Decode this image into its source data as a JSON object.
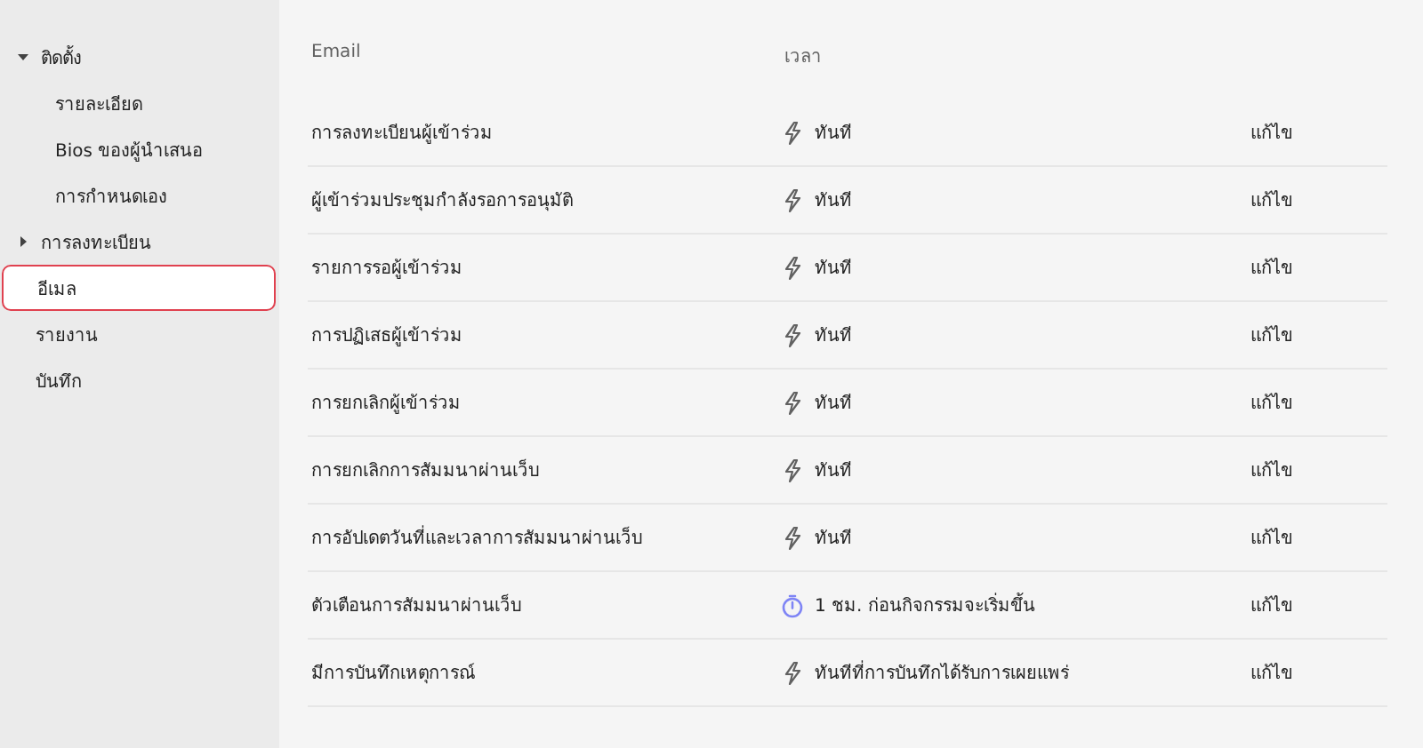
{
  "sidebar": {
    "items": [
      {
        "label": "ติดตั้ง",
        "expanded": true,
        "selected": false,
        "children": [
          {
            "label": "รายละเอียด",
            "selected": false
          },
          {
            "label": "Bios ของผู้นำเสนอ",
            "selected": false
          },
          {
            "label": "การกำหนดเอง",
            "selected": false
          }
        ]
      },
      {
        "label": "การลงทะเบียน",
        "expanded": false,
        "selected": false
      },
      {
        "label": "อีเมล",
        "selected": true
      },
      {
        "label": "รายงาน",
        "selected": false
      },
      {
        "label": "บันทึก",
        "selected": false
      }
    ]
  },
  "table": {
    "columns": [
      "Email",
      "เวลา"
    ],
    "rows": [
      {
        "email": "การลงทะเบียนผู้เข้าร่วม",
        "timing": {
          "kind": "instant",
          "text": "ทันที"
        },
        "action": "แก้ไข"
      },
      {
        "email": "ผู้เข้าร่วมประชุมกำลังรอการอนุมัติ",
        "timing": {
          "kind": "instant",
          "text": "ทันที"
        },
        "action": "แก้ไข"
      },
      {
        "email": "รายการรอผู้เข้าร่วม",
        "timing": {
          "kind": "instant",
          "text": "ทันที"
        },
        "action": "แก้ไข"
      },
      {
        "email": "การปฏิเสธผู้เข้าร่วม",
        "timing": {
          "kind": "instant",
          "text": "ทันที"
        },
        "action": "แก้ไข"
      },
      {
        "email": "การยกเลิกผู้เข้าร่วม",
        "timing": {
          "kind": "instant",
          "text": "ทันที"
        },
        "action": "แก้ไข"
      },
      {
        "email": "การยกเลิกการสัมมนาผ่านเว็บ",
        "timing": {
          "kind": "instant",
          "text": "ทันที"
        },
        "action": "แก้ไข"
      },
      {
        "email": "การอัปเดตวันที่และเวลาการสัมมนาผ่านเว็บ",
        "timing": {
          "kind": "instant",
          "text": "ทันที"
        },
        "action": "แก้ไข"
      },
      {
        "email": "ตัวเตือนการสัมมนาผ่านเว็บ",
        "timing": {
          "kind": "timer",
          "text": "1 ชม. ก่อนกิจกรรมจะเริ่มขึ้น"
        },
        "action": "แก้ไข"
      },
      {
        "email": "มีการบันทึกเหตุการณ์",
        "timing": {
          "kind": "instant",
          "text": "ทันทีที่การบันทึกได้รับการเผยแพร่"
        },
        "action": "แก้ไข"
      }
    ]
  }
}
